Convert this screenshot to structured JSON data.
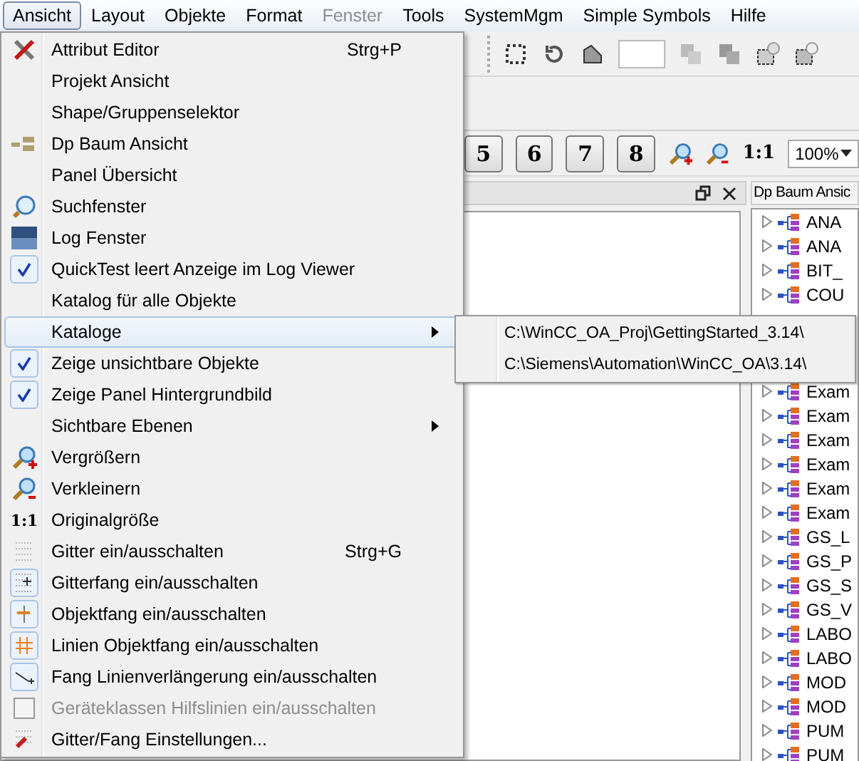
{
  "menubar": [
    {
      "label": "Ansicht",
      "selected": true,
      "disabled": false
    },
    {
      "label": "Layout",
      "selected": false,
      "disabled": false
    },
    {
      "label": "Objekte",
      "selected": false,
      "disabled": false
    },
    {
      "label": "Format",
      "selected": false,
      "disabled": false
    },
    {
      "label": "Fenster",
      "selected": false,
      "disabled": true
    },
    {
      "label": "Tools",
      "selected": false,
      "disabled": false
    },
    {
      "label": "SystemMgm",
      "selected": false,
      "disabled": false
    },
    {
      "label": "Simple Symbols",
      "selected": false,
      "disabled": false
    },
    {
      "label": "Hilfe",
      "selected": false,
      "disabled": false
    }
  ],
  "menu": [
    {
      "kind": "command",
      "label": "Attribut Editor",
      "shortcut": "Strg+P",
      "selected": false,
      "disabled": false
    },
    {
      "kind": "command",
      "label": "Projekt Ansicht",
      "selected": false,
      "disabled": false
    },
    {
      "kind": "command",
      "label": "Shape/Gruppenselektor",
      "selected": false,
      "disabled": false
    },
    {
      "kind": "command",
      "label": "Dp Baum Ansicht",
      "selected": false,
      "disabled": false
    },
    {
      "kind": "command",
      "label": "Panel Übersicht",
      "selected": false,
      "disabled": false
    },
    {
      "kind": "command",
      "label": "Suchfenster",
      "selected": false,
      "disabled": false
    },
    {
      "kind": "command",
      "label": "Log Fenster",
      "selected": false,
      "disabled": false
    },
    {
      "kind": "toggle",
      "label": "QuickTest leert Anzeige im Log Viewer",
      "checked": true,
      "selected": false,
      "disabled": false
    },
    {
      "kind": "command",
      "label": "Katalog für alle Objekte",
      "selected": false,
      "disabled": false
    },
    {
      "kind": "submenu",
      "label": "Kataloge",
      "selected": true,
      "disabled": false,
      "children": [
        {
          "label": "C:\\WinCC_OA_Proj\\GettingStarted_3.14\\"
        },
        {
          "label": "C:\\Siemens\\Automation\\WinCC_OA\\3.14\\"
        }
      ]
    },
    {
      "kind": "toggle",
      "label": "Zeige unsichtbare Objekte",
      "checked": true,
      "selected": false,
      "disabled": false
    },
    {
      "kind": "toggle",
      "label": "Zeige Panel Hintergrundbild",
      "checked": true,
      "selected": false,
      "disabled": false
    },
    {
      "kind": "submenu",
      "label": "Sichtbare Ebenen",
      "selected": false,
      "disabled": false
    },
    {
      "kind": "command",
      "label": "Vergrößern",
      "selected": false,
      "disabled": false
    },
    {
      "kind": "command",
      "label": "Verkleinern",
      "selected": false,
      "disabled": false
    },
    {
      "kind": "command",
      "label": "Originalgröße",
      "icon_text": "1:1",
      "selected": false,
      "disabled": false
    },
    {
      "kind": "icon_toggle",
      "label": "Gitter ein/ausschalten",
      "shortcut": "Strg+G",
      "checked": false,
      "selected": false,
      "disabled": false
    },
    {
      "kind": "icon_toggle",
      "label": "Gitterfang ein/ausschalten",
      "checked": true,
      "selected": false,
      "disabled": false
    },
    {
      "kind": "icon_toggle",
      "label": "Objektfang ein/ausschalten",
      "checked": true,
      "selected": false,
      "disabled": false
    },
    {
      "kind": "icon_toggle",
      "label": "Linien Objektfang ein/ausschalten",
      "checked": true,
      "selected": false,
      "disabled": false
    },
    {
      "kind": "icon_toggle",
      "label": "Fang Linienverlängerung ein/ausschalten",
      "checked": true,
      "selected": false,
      "disabled": false
    },
    {
      "kind": "icon_toggle",
      "label": "Geräteklassen Hilfslinien ein/ausschalten",
      "checked": false,
      "selected": false,
      "disabled": true
    },
    {
      "kind": "command",
      "label": "Gitter/Fang Einstellungen...",
      "selected": false,
      "disabled": false
    }
  ],
  "layer_buttons": [
    "5",
    "6",
    "7",
    "8"
  ],
  "zoom_label": "1:1",
  "zoom_select": {
    "value": "100%"
  },
  "dock": {
    "tab": "Dp Baum Ansic",
    "tree_top": [
      "ANA",
      "ANA",
      "BIT_",
      "COU"
    ],
    "tree_bottom": [
      "Exam",
      "Exam",
      "Exam",
      "Exam",
      "Exam",
      "Exam",
      "GS_L",
      "GS_P",
      "GS_S",
      "GS_V",
      "LABO",
      "LABO",
      "MOD",
      "MOD",
      "PUM",
      "PUM"
    ]
  }
}
